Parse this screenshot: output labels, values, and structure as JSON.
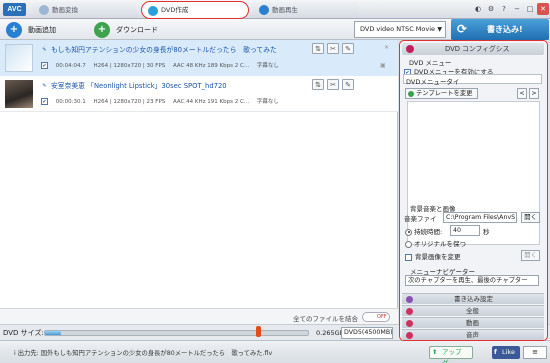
{
  "app": {
    "logo": "AVC"
  },
  "tabs": [
    {
      "label": "動画変換"
    },
    {
      "label": "DVD作成"
    },
    {
      "label": "動画再生"
    }
  ],
  "window_controls": [
    "◐",
    "⚙",
    "?",
    "−",
    "□",
    "✕"
  ],
  "toolbar": {
    "add_video": "動画追加",
    "download": "ダウンロード",
    "dvd_format": "DVD video NTSC Movie",
    "burn": "書き込み!"
  },
  "files": [
    {
      "title": "もしも知円アテンションの少女の身長が80メートルだったら　歌ってみた",
      "duration": "00:04:04.7",
      "codec": "H264 | 1280x720 | 30 FPS",
      "audio": "AAC 48 KHz 189 Kbps 2 C...",
      "subtitle": "字幕なし"
    },
    {
      "title": "安室奈美恵 「Neonlight Lipstick」30sec SPOT_hd720",
      "duration": "00:00:30.1",
      "codec": "H264 | 1280x720 | 23 FPS",
      "audio": "AAC 44 KHz 191 Kbps 2 C...",
      "subtitle": "字幕なし"
    }
  ],
  "merge": {
    "label": "全てのファイルを結合",
    "toggle": "OFF"
  },
  "size": {
    "label": "DVD サイズ:",
    "value": "0.265Gb/4.500Gb",
    "disc": "DVD5(4500MB)",
    "fill_percent": 6
  },
  "status": {
    "text": "i  出力先: 国外もしも知円アテンションの少女の身長が80メートルだったら　歌ってみた.flv",
    "upgrade": "アップグ...",
    "like": "Like"
  },
  "panel": {
    "header": "DVD コンフィグシス",
    "dvd_menu_section": "DVD メニュー",
    "enable_menu": "DVDメニューを有効にする",
    "menu_title": "DVDメニュータイ",
    "template_button": "テンプレートを変更",
    "bg_section": "背景音楽と画像",
    "bg_music_label": "音楽ファイ",
    "bg_music_path": "C:\\Program Files\\AnvS",
    "open_button": "開く",
    "duration_label": "持続時間:",
    "duration_value": "40",
    "duration_unit": "秒",
    "original_label": "オリジナルを保つ",
    "bg_image_label": "背景画像を変更",
    "open_button_2": "開く",
    "nav_section": "メニューナビゲーター",
    "nav_value": "次のチャプターを再生、最後のチャプター",
    "sections": [
      "書き込み設定",
      "全般",
      "動画",
      "音声"
    ]
  }
}
